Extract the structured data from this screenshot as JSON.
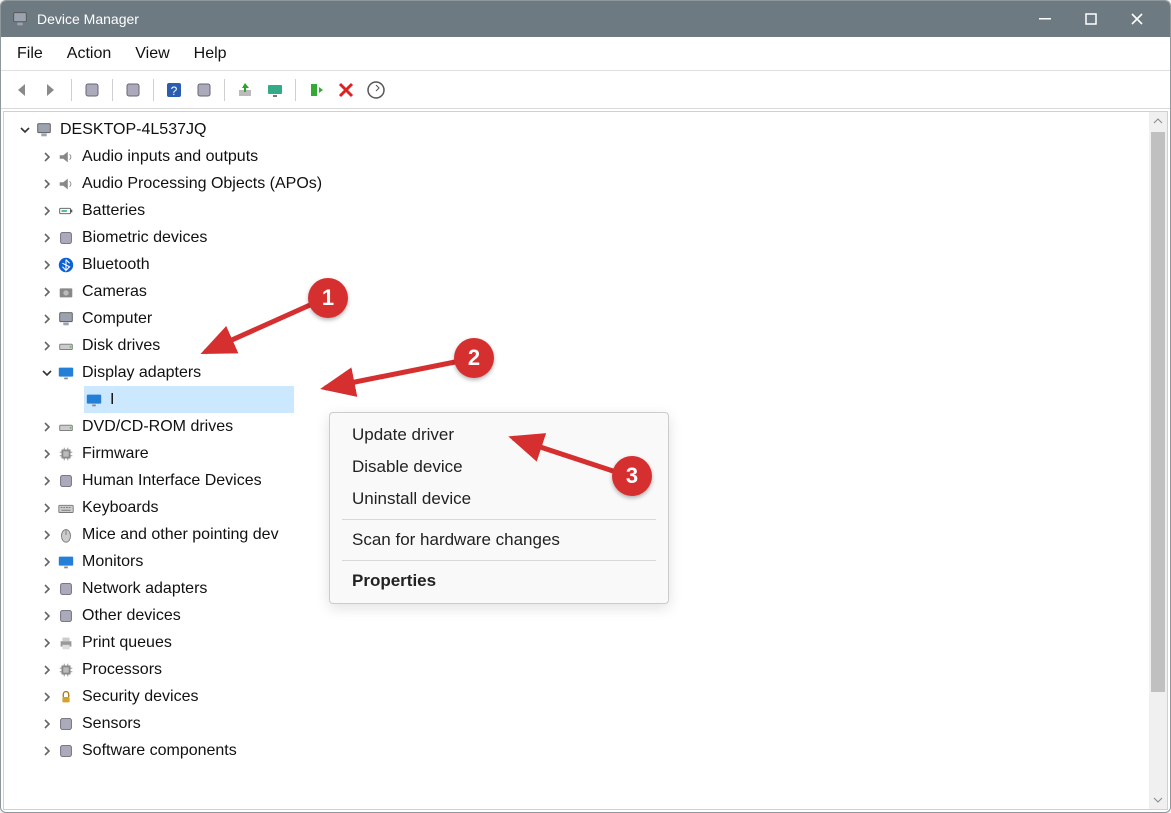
{
  "window": {
    "title": "Device Manager"
  },
  "menus": {
    "file": "File",
    "action": "Action",
    "view": "View",
    "help": "Help"
  },
  "tree": {
    "root": "DESKTOP-4L537JQ",
    "categories": [
      "Audio inputs and outputs",
      "Audio Processing Objects (APOs)",
      "Batteries",
      "Biometric devices",
      "Bluetooth",
      "Cameras",
      "Computer",
      "Disk drives",
      "Display adapters",
      "DVD/CD-ROM drives",
      "Firmware",
      "Human Interface Devices",
      "Keyboards",
      "Mice and other pointing dev",
      "Monitors",
      "Network adapters",
      "Other devices",
      "Print queues",
      "Processors",
      "Security devices",
      "Sensors",
      "Software components"
    ],
    "selected_device": "I",
    "expanded_index": 8
  },
  "context_menu": {
    "update": "Update driver",
    "disable": "Disable device",
    "uninstall": "Uninstall device",
    "scan": "Scan for hardware changes",
    "properties": "Properties"
  },
  "annotations": {
    "b1": "1",
    "b2": "2",
    "b3": "3"
  },
  "icon_keys": [
    "computer",
    "speaker",
    "apo",
    "battery",
    "fingerprint",
    "bluetooth",
    "camera",
    "pc",
    "disk",
    "display",
    "dvd",
    "firmware",
    "hid",
    "keyboard",
    "mouse",
    "monitor",
    "network",
    "other",
    "printer",
    "cpu",
    "security",
    "sensor",
    "software"
  ]
}
